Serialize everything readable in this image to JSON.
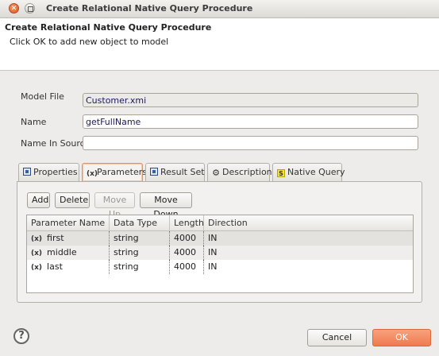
{
  "window": {
    "title": "Create Relational Native Query Procedure"
  },
  "header": {
    "title": "Create Relational Native Query Procedure",
    "message": "Click OK to add new object to model"
  },
  "form": {
    "model_file_label": "Model File",
    "model_file_value": "Customer.xmi",
    "name_label": "Name",
    "name_value": "getFullName",
    "name_in_source_label": "Name In Source",
    "name_in_source_value": ""
  },
  "tabs": [
    {
      "label": "Properties",
      "icon": "properties-icon"
    },
    {
      "label": "Parameters",
      "icon": "parameters-icon",
      "active": true
    },
    {
      "label": "Result Set",
      "icon": "result-set-icon"
    },
    {
      "label": "Description",
      "icon": "description-icon"
    },
    {
      "label": "Native Query",
      "icon": "native-query-icon"
    }
  ],
  "toolbar": {
    "add": "Add",
    "delete": "Delete",
    "move_up": "Move Up",
    "move_down": "Move Down"
  },
  "table": {
    "columns": [
      "Parameter Name",
      "Data Type",
      "Length",
      "Direction"
    ],
    "rows": [
      {
        "name": "first",
        "type": "string",
        "length": "4000",
        "direction": "IN"
      },
      {
        "name": "middle",
        "type": "string",
        "length": "4000",
        "direction": "IN"
      },
      {
        "name": "last",
        "type": "string",
        "length": "4000",
        "direction": "IN"
      }
    ]
  },
  "footer": {
    "help": "?",
    "cancel": "Cancel",
    "ok": "OK"
  },
  "colors": {
    "accent": "#ef7a4f",
    "background": "#edeceb"
  }
}
